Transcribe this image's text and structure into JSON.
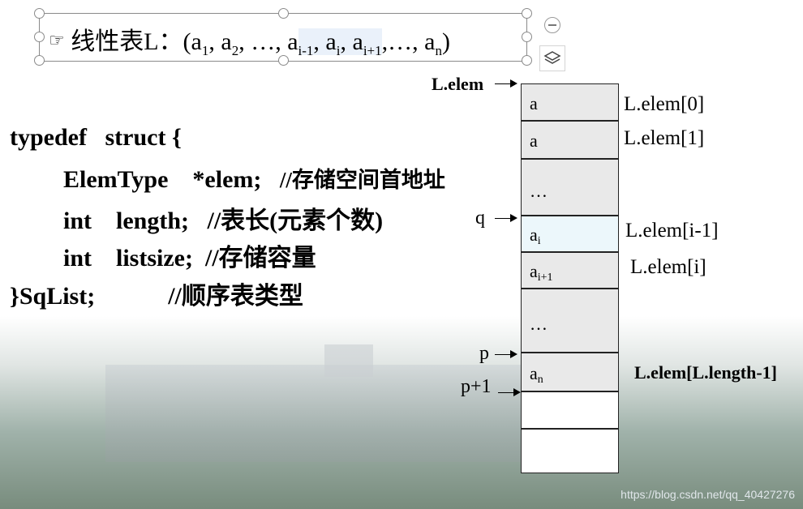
{
  "title": {
    "prefix_icon": "pointing-hand-icon",
    "text_intro": "线性表L：(a",
    "s1": "1",
    "mid1": ", a",
    "s2": "2",
    "mid2": ", …, a",
    "s3": "i-1",
    "mid3": ", a",
    "s4": "i",
    "mid4": ", a",
    "s5": "i+1",
    "mid5": ",…, a",
    "s6": "n",
    "end": ")"
  },
  "code": {
    "line1": "typedef   struct {",
    "line2_a": "ElemType    *elem;",
    "line2_c": "//存储空间首地址",
    "line3_a": "int    length;",
    "line3_c": "//表长(元素个数)",
    "line4_a": "int    listsize;",
    "line4_c": "//存储容量",
    "line5_a": "}SqList;",
    "line5_c": "//顺序表类型"
  },
  "memory": {
    "elem_ptr_label": "L.elem",
    "cells": [
      {
        "base": "a",
        "sub": ""
      },
      {
        "base": "a",
        "sub": ""
      },
      {
        "base": "…",
        "sub": ""
      },
      {
        "base": "a",
        "sub": "i"
      },
      {
        "base": "a",
        "sub": "i+1"
      },
      {
        "base": "…",
        "sub": ""
      },
      {
        "base": "a",
        "sub": "n"
      },
      {
        "base": "",
        "sub": ""
      },
      {
        "base": "",
        "sub": ""
      }
    ],
    "index_labels": {
      "l0": "L.elem[0]",
      "l1": "L.elem[1]",
      "li1": "L.elem[i-1]",
      "li": "L.elem[i]",
      "llast": "L.elem[L.length-1]"
    },
    "pointers": {
      "q": "q",
      "p": "p",
      "p1": "p+1"
    }
  },
  "toolbar": {
    "icons": [
      "collapse-icon",
      "layers-icon",
      "brush-icon",
      "fill-icon",
      "frame-icon",
      "translate-icon",
      "text-convert-icon"
    ]
  },
  "watermark": "https://blog.csdn.net/qq_40427276"
}
